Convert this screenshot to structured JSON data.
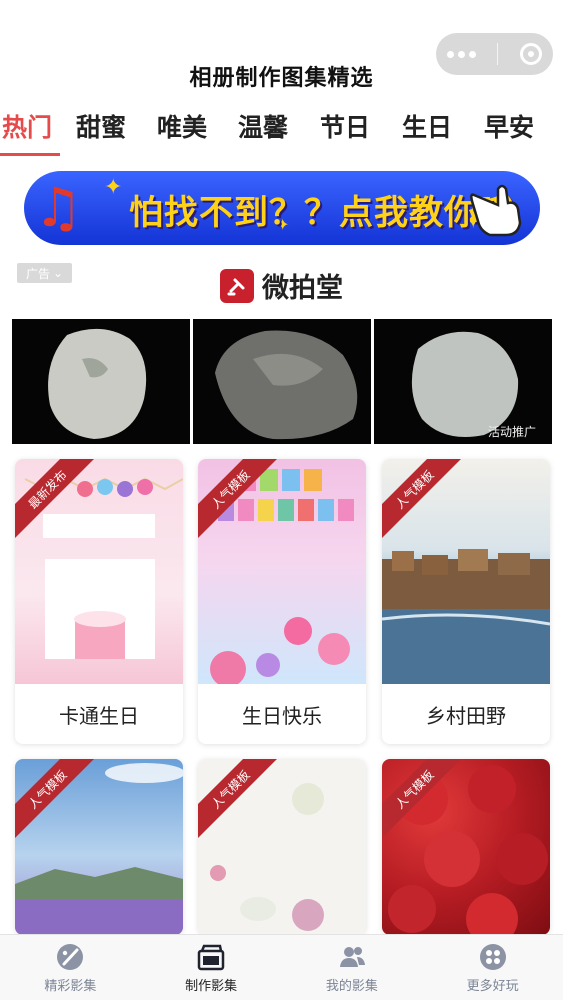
{
  "page": {
    "title": "相册制作图集精选"
  },
  "tabs": [
    {
      "label": "热门",
      "active": true
    },
    {
      "label": "甜蜜"
    },
    {
      "label": "唯美"
    },
    {
      "label": "温馨"
    },
    {
      "label": "节日"
    },
    {
      "label": "生日"
    },
    {
      "label": "早安"
    }
  ],
  "banner": {
    "text": "怕找不到？？点我教你哦~"
  },
  "ad": {
    "tag": "广告",
    "brand": "微拍堂",
    "promo": "活动推广"
  },
  "cards": [
    {
      "label": "卡通生日",
      "ribbon": "最新发布"
    },
    {
      "label": "生日快乐",
      "ribbon": "人气模板"
    },
    {
      "label": "乡村田野",
      "ribbon": "人气模板"
    },
    {
      "label": "",
      "ribbon": "人气模板"
    },
    {
      "label": "",
      "ribbon": "人气模板"
    },
    {
      "label": "",
      "ribbon": "人气模板"
    }
  ],
  "bottom_nav": [
    {
      "label": "精彩影集",
      "icon": "palette-icon"
    },
    {
      "label": "制作影集",
      "icon": "album-icon",
      "active": true
    },
    {
      "label": "我的影集",
      "icon": "users-icon"
    },
    {
      "label": "更多好玩",
      "icon": "grid-icon"
    }
  ],
  "colors": {
    "accent": "#e64b4b",
    "ribbon": "#b8282f",
    "banner": "#1f45e8"
  }
}
